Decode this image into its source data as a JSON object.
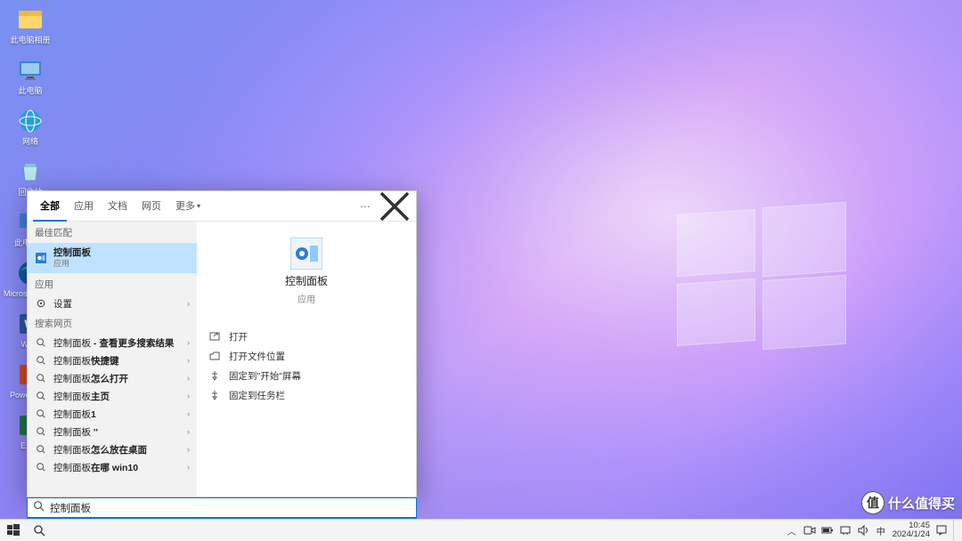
{
  "desktop_icons": [
    {
      "label": "此电脑相册"
    },
    {
      "label": "此电脑"
    },
    {
      "label": "网络"
    },
    {
      "label": "回收站"
    },
    {
      "label": "此电脑名"
    },
    {
      "label": "Microsoft Edge"
    },
    {
      "label": "Word"
    },
    {
      "label": "PowerPoint"
    },
    {
      "label": "Excel"
    }
  ],
  "search": {
    "tabs": {
      "all": "全部",
      "apps": "应用",
      "docs": "文档",
      "web": "网页",
      "more": "更多"
    },
    "sections": {
      "best": "最佳匹配",
      "apps": "应用",
      "web": "搜索网页"
    },
    "best": {
      "name": "控制面板",
      "kind": "应用"
    },
    "apps_item": "设置",
    "web_items": [
      {
        "pre": "控制面板",
        "suf": " - 查看更多搜索结果"
      },
      {
        "pre": "控制面板",
        "suf": "快捷键"
      },
      {
        "pre": "控制面板",
        "suf": "怎么打开"
      },
      {
        "pre": "控制面板",
        "suf": "主页"
      },
      {
        "pre": "控制面板",
        "suf": "1"
      },
      {
        "pre": "控制面板",
        "suf": " ''"
      },
      {
        "pre": "控制面板",
        "suf": "怎么放在桌面"
      },
      {
        "pre": "控制面板",
        "suf": "在哪 win10"
      }
    ],
    "preview": {
      "title": "控制面板",
      "sub": "应用"
    },
    "actions": [
      "打开",
      "打开文件位置",
      "固定到\"开始\"屏幕",
      "固定到任务栏"
    ],
    "input_value": "控制面板"
  },
  "tray": {
    "ime": "中",
    "time": "10:45",
    "date": "2024/1/24"
  },
  "watermark": "什么值得买"
}
